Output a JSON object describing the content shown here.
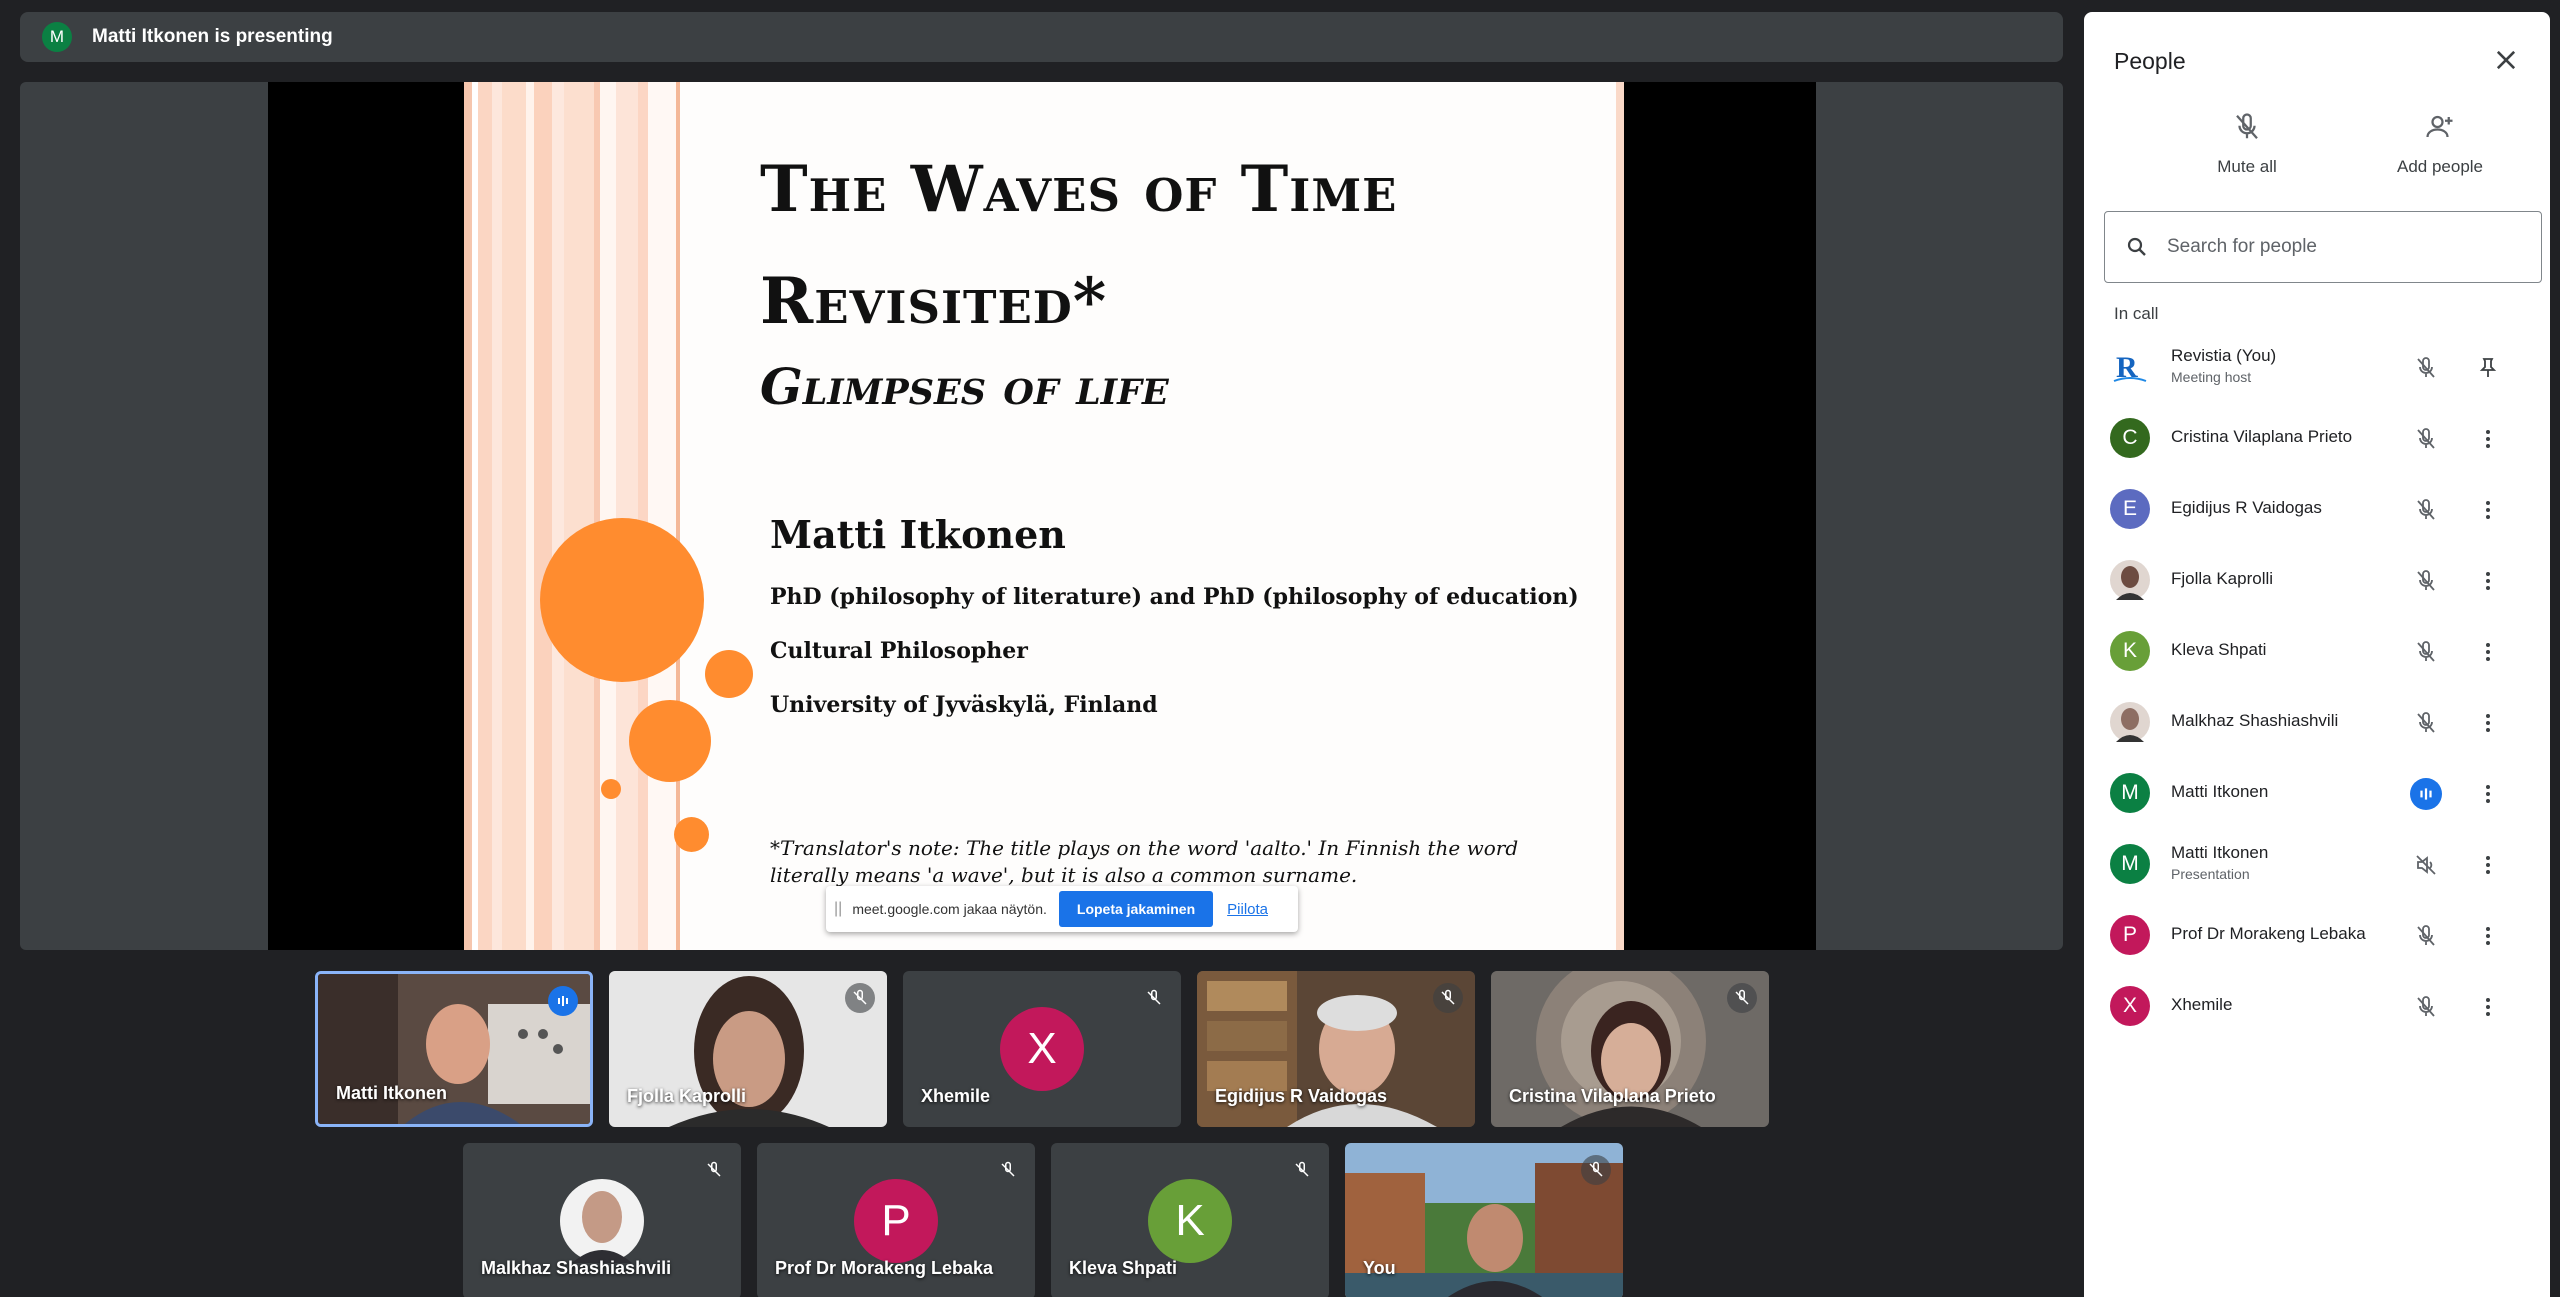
{
  "presenting_bar": {
    "avatar_letter": "M",
    "text": "Matti Itkonen is presenting"
  },
  "slide": {
    "title_line1": "The Waves of Time",
    "title_line2": "Revisited*",
    "subtitle": "Glimpses of life",
    "author": "Matti Itkonen",
    "line1": "PhD (philosophy of literature) and PhD (philosophy of education)",
    "line2": "Cultural Philosopher",
    "line3": "University of Jyväskylä, Finland",
    "note": "*Translator's note: The title plays on the word 'aalto.' In Finnish the word literally means 'a wave', but it is also a common surname."
  },
  "share_bar": {
    "grip": "||",
    "message": "meet.google.com jakaa näytön.",
    "stop_label": "Lopeta jakaminen",
    "hide_label": "Piilota"
  },
  "tiles": [
    {
      "name": "Matti Itkonen",
      "type": "video",
      "mic": "speaking",
      "active": true
    },
    {
      "name": "Fjolla Kaprolli",
      "type": "video",
      "mic": "muted"
    },
    {
      "name": "Xhemile",
      "type": "avatar",
      "letter": "X",
      "color": "#c2185b",
      "mic": "muted"
    },
    {
      "name": "Egidijus R Vaidogas",
      "type": "video",
      "mic": "muted"
    },
    {
      "name": "Cristina Vilaplana Prieto",
      "type": "video",
      "mic": "muted"
    },
    {
      "name": "Malkhaz Shashiashvili",
      "type": "photo",
      "mic": "muted"
    },
    {
      "name": "Prof Dr Morakeng Lebaka",
      "type": "avatar",
      "letter": "P",
      "color": "#c2185b",
      "mic": "muted"
    },
    {
      "name": "Kleva Shpati",
      "type": "avatar",
      "letter": "K",
      "color": "#689f38",
      "mic": "muted"
    },
    {
      "name": "You",
      "type": "video",
      "mic": "muted"
    }
  ],
  "panel": {
    "title": "People",
    "mute_all_label": "Mute all",
    "add_people_label": "Add people",
    "search_placeholder": "Search for people",
    "section_label": "In call",
    "people": [
      {
        "name": "Revistia (You)",
        "sub": "Meeting host",
        "avatar": "logo",
        "color": "#1565c0",
        "mic": "muted",
        "action": "pin-icon"
      },
      {
        "name": "Cristina Vilaplana Prieto",
        "avatar": "C",
        "color": "#33691e",
        "mic": "muted",
        "action": "more-icon"
      },
      {
        "name": "Egidijus R Vaidogas",
        "avatar": "E",
        "color": "#5c6bc0",
        "mic": "muted",
        "action": "more-icon"
      },
      {
        "name": "Fjolla Kaprolli",
        "avatar": "photo",
        "color": "#6d4c41",
        "mic": "muted",
        "action": "more-icon"
      },
      {
        "name": "Kleva Shpati",
        "avatar": "K",
        "color": "#689f38",
        "mic": "muted",
        "action": "more-icon"
      },
      {
        "name": "Malkhaz Shashiashvili",
        "avatar": "photo",
        "color": "#8d6e63",
        "mic": "muted",
        "action": "more-icon"
      },
      {
        "name": "Matti Itkonen",
        "avatar": "M",
        "color": "#0b8043",
        "mic": "speaking",
        "action": "more-icon"
      },
      {
        "name": "Matti Itkonen",
        "sub": "Presentation",
        "avatar": "M",
        "color": "#0b8043",
        "mic": "presentation-muted",
        "action": "more-icon"
      },
      {
        "name": "Prof Dr Morakeng Lebaka",
        "avatar": "P",
        "color": "#c2185b",
        "mic": "muted",
        "action": "more-icon"
      },
      {
        "name": "Xhemile",
        "avatar": "X",
        "color": "#c2185b",
        "mic": "muted",
        "action": "more-icon"
      }
    ]
  }
}
